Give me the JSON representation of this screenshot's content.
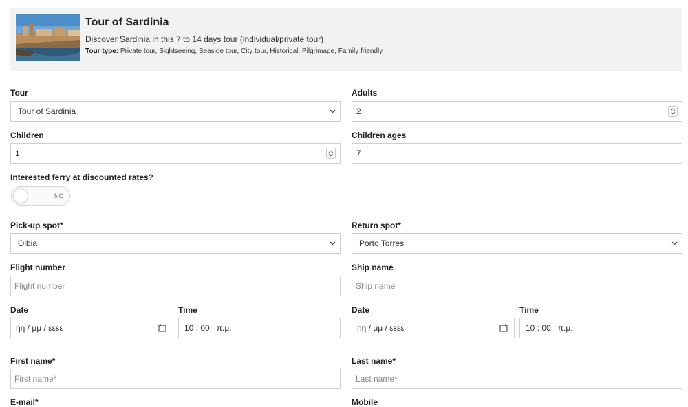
{
  "tour": {
    "title": "Tour of Sardinia",
    "description": "Discover Sardinia in this 7 to 14 days tour (individual/private tour)",
    "type_label": "Tour type:",
    "type_value": " Private tour, Sightseeing, Seaside tour, City tour, Historical, Pilgrimage, Family friendly"
  },
  "form": {
    "tour": {
      "label": "Tour",
      "value": "Tour of Sardinia"
    },
    "adults": {
      "label": "Adults",
      "value": "2"
    },
    "children": {
      "label": "Children",
      "value": "1"
    },
    "children_ages": {
      "label": "Children ages",
      "value": "7"
    },
    "ferry": {
      "label": "Interested ferry at discounted rates?",
      "state": "NO"
    },
    "pickup": {
      "label": "Pick-up spot*",
      "value": "Olbia"
    },
    "return": {
      "label": "Return spot*",
      "value": "Porto Torres"
    },
    "flight": {
      "label": "Flight number",
      "placeholder": "Flight number"
    },
    "ship": {
      "label": "Ship name",
      "placeholder": "Ship name"
    },
    "date_left": {
      "label": "Date",
      "value": "ηη / μμ / εεεε"
    },
    "time_left": {
      "label": "Time",
      "value": "10 : 00   π.μ."
    },
    "date_right": {
      "label": "Date",
      "value": "ηη / μμ / εεεε"
    },
    "time_right": {
      "label": "Time",
      "value": "10 : 00   π.μ."
    },
    "first_name": {
      "label": "First name*",
      "placeholder": "First name*"
    },
    "last_name": {
      "label": "Last name*",
      "placeholder": "Last name*"
    },
    "email": {
      "label": "E-mail*"
    },
    "mobile": {
      "label": "Mobile"
    }
  },
  "colors": {
    "header_bg": "#f2f2f2",
    "border": "#cfcfcf",
    "placeholder": "#8a8a8a"
  }
}
